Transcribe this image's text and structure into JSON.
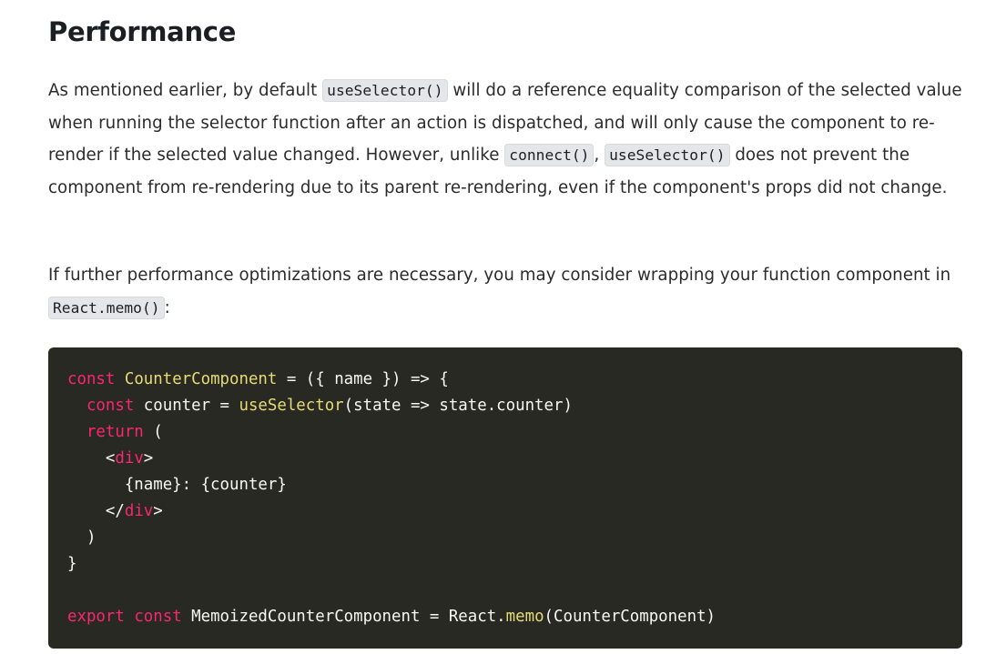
{
  "heading": "Performance",
  "paragraph1": {
    "seg1": "As mentioned earlier, by default ",
    "code1": "useSelector()",
    "seg2": " will do a reference equality comparison of the selected value when running the selector function after an action is dispatched, and will only cause the component to re-render if the selected value changed. However, unlike ",
    "code2": "connect()",
    "seg3": ", ",
    "code3": "useSelector()",
    "seg4": " does not prevent the component from re-rendering due to its parent re-rendering, even if the component's props did not change."
  },
  "paragraph2": {
    "seg1": "If further performance optimizations are necessary, you may consider wrapping your function component in ",
    "code1": "React.memo()",
    "seg2": ":"
  },
  "code": {
    "l1_kw": "const",
    "l1_fn": "CounterComponent",
    "l1_rest": " = ({ name }) => {",
    "l2_kw": "const",
    "l2_mid": " counter = ",
    "l2_fn": "useSelector",
    "l2_rest": "(state => state.counter)",
    "l3_kw": "return",
    "l3_rest": " (",
    "l4_open": "<",
    "l4_tag": "div",
    "l4_close": ">",
    "l5": "{name}: {counter}",
    "l6_open": "</",
    "l6_tag": "div",
    "l6_close": ">",
    "l7": ")",
    "l8": "}",
    "l10_kw1": "export",
    "l10_kw2": "const",
    "l10_mid": " MemoizedCounterComponent = React.",
    "l10_fn": "memo",
    "l10_rest": "(CounterComponent)"
  },
  "colors": {
    "code_bg": "#282923",
    "keyword": "#f92672",
    "function": "#e6db74",
    "plain": "#f8f8f2",
    "inline_code_bg": "#e4e6ea"
  }
}
